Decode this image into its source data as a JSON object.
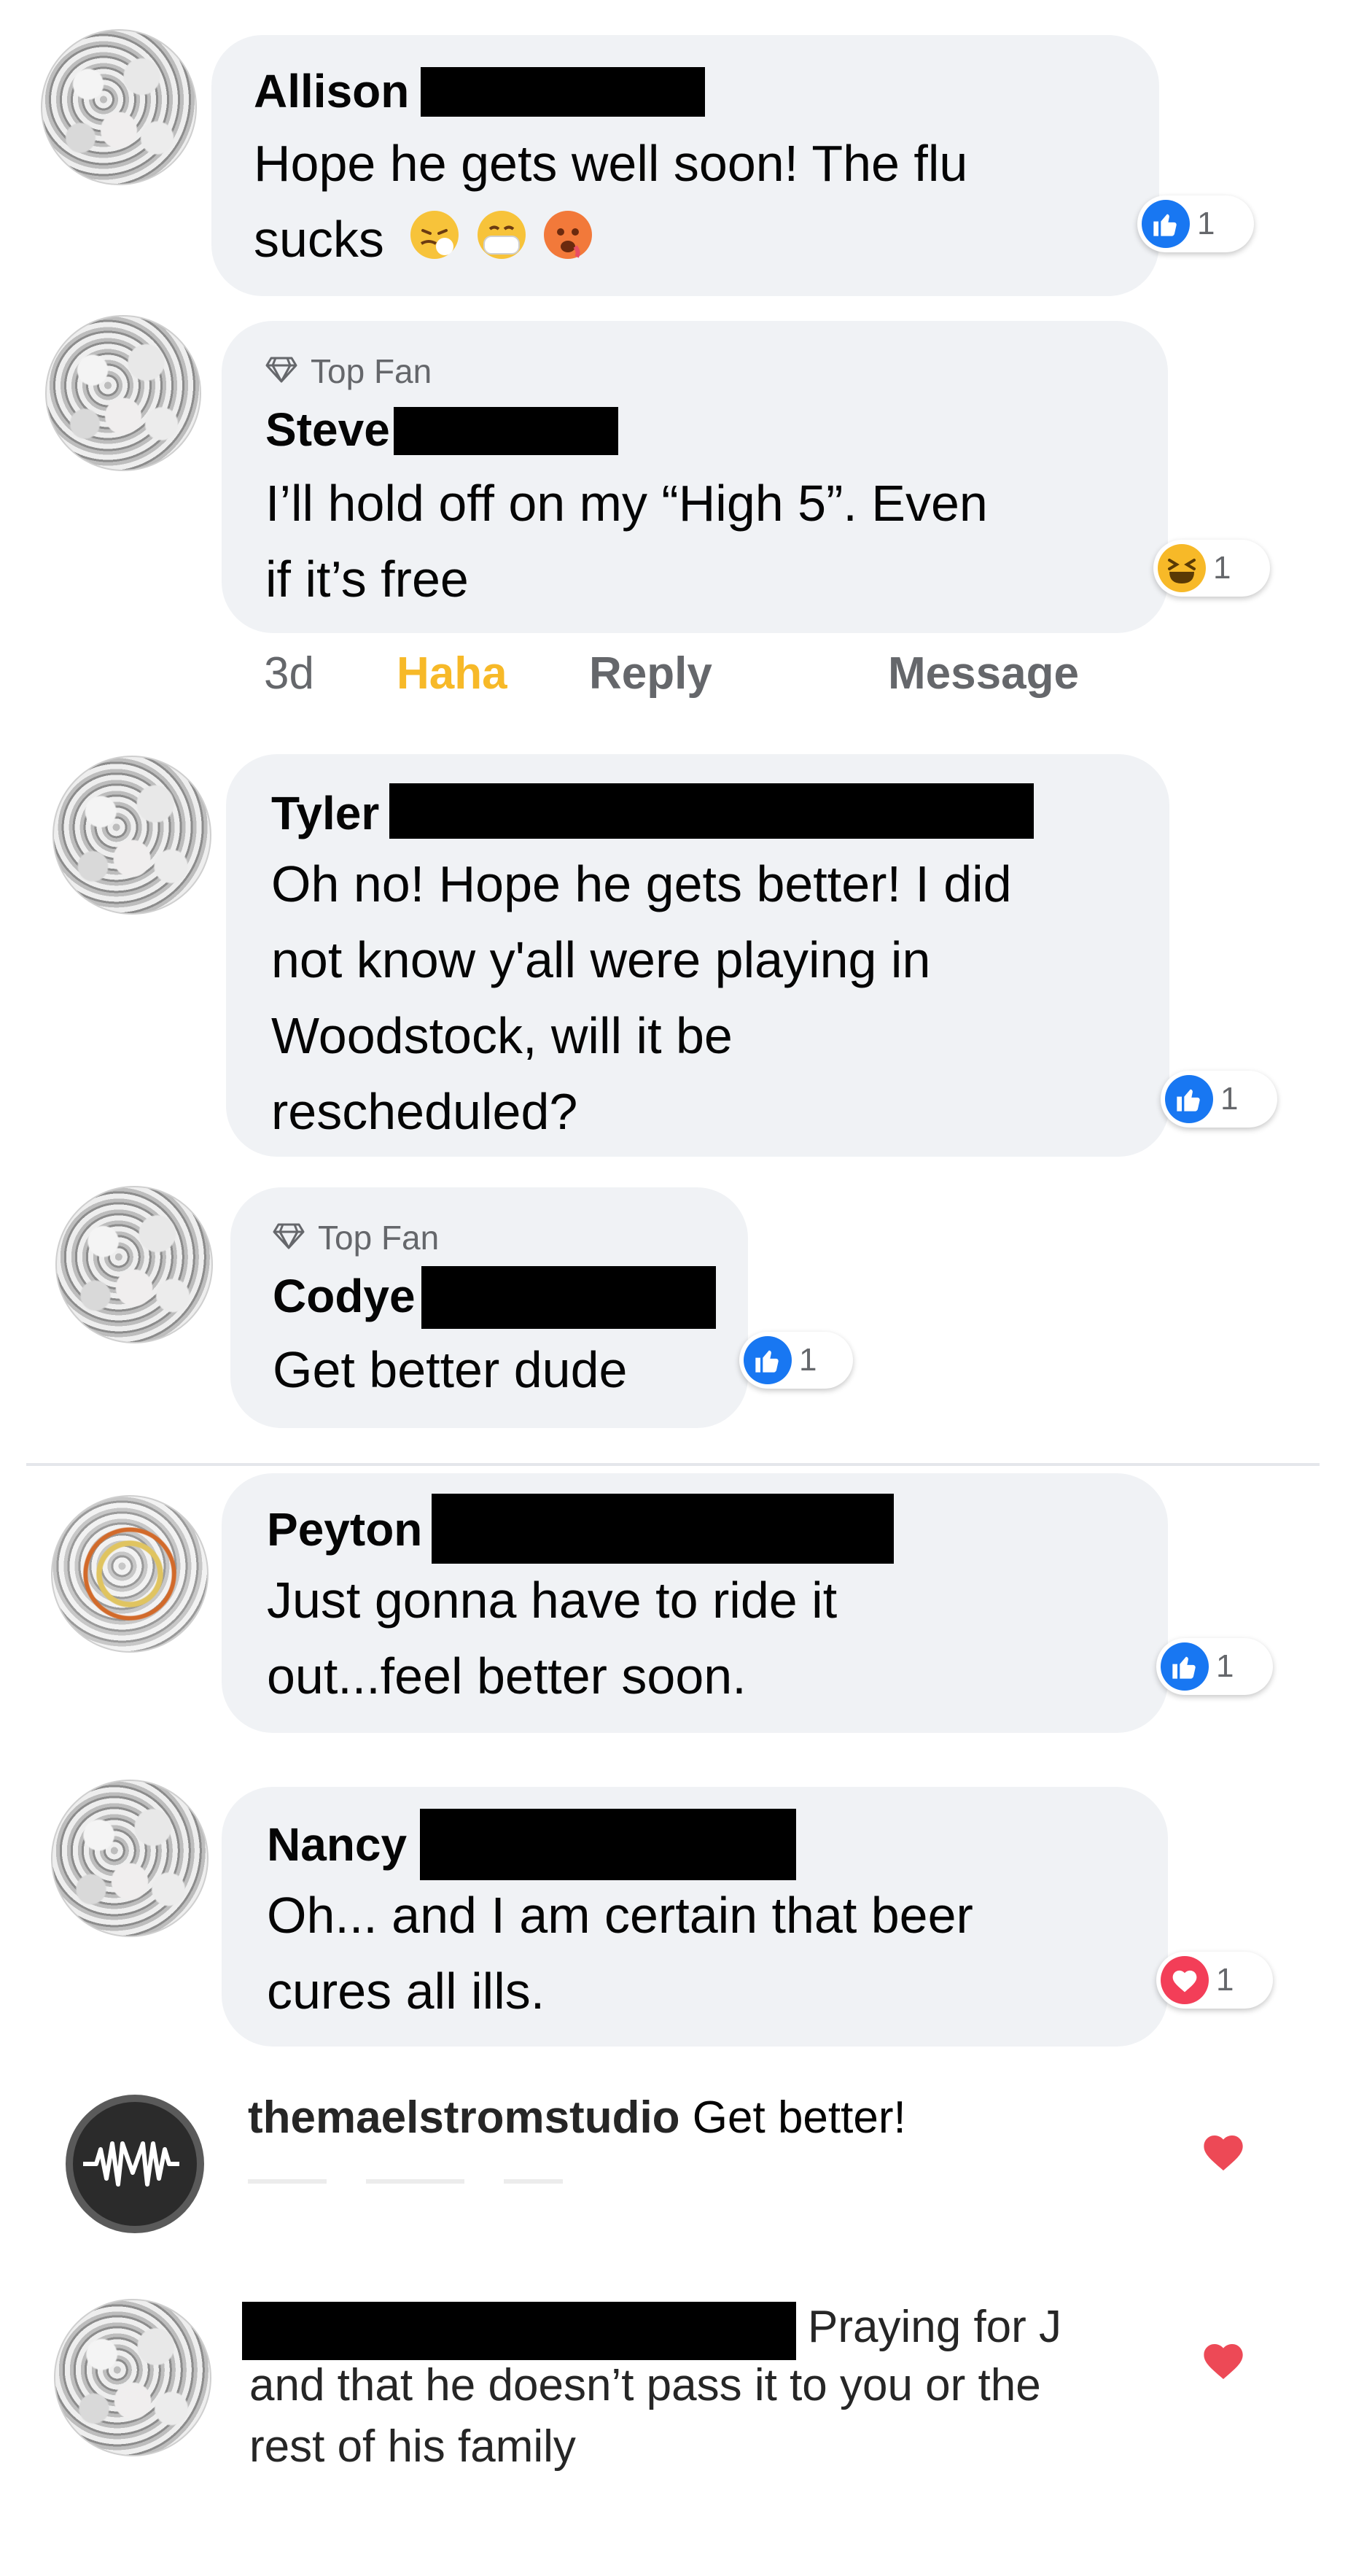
{
  "comments": [
    {
      "name": "Allison",
      "text_lines": [
        "Hope he gets well soon!  The flu",
        "sucks"
      ],
      "reaction": {
        "icon": "like-icon",
        "count": "1"
      }
    },
    {
      "badge": "Top Fan",
      "name": "Steve",
      "text_lines": [
        "I’ll hold off on my “High 5”. Even",
        "if it’s free"
      ],
      "reaction": {
        "icon": "haha-icon",
        "count": "1"
      },
      "actions": {
        "time": "3d",
        "haha": "Haha",
        "reply": "Reply",
        "message": "Message"
      }
    },
    {
      "name": "Tyler",
      "text_lines": [
        "Oh no! Hope he gets better! I did",
        "not know y'all were playing in",
        "Woodstock, will it be",
        "rescheduled?"
      ],
      "reaction": {
        "icon": "like-icon",
        "count": "1"
      }
    },
    {
      "badge": "Top Fan",
      "name": "Codye",
      "text_lines": [
        "Get better dude"
      ],
      "reaction": {
        "icon": "like-icon",
        "count": "1"
      }
    },
    {
      "name": "Peyton",
      "text_lines": [
        "Just gonna have to ride it",
        "out...feel better soon."
      ],
      "reaction": {
        "icon": "like-icon",
        "count": "1"
      }
    },
    {
      "name": "Nancy",
      "text_lines": [
        "Oh... and I am certain that beer",
        "cures all ills."
      ],
      "reaction": {
        "icon": "love-icon",
        "count": "1"
      }
    }
  ],
  "instagram": [
    {
      "username": "themaelstromstudio",
      "text": "Get better!"
    },
    {
      "text_line1": "Praying for J",
      "text_line2": "and that he doesn’t pass it to you or the",
      "text_line3": "rest of his family"
    }
  ],
  "colors": {
    "like": "#1877f2",
    "haha": "#f7b928",
    "love": "#f33e58",
    "accent_haha_label": "#f7b928",
    "bubble": "#f0f2f5",
    "ig_heart": "#ed4956"
  }
}
